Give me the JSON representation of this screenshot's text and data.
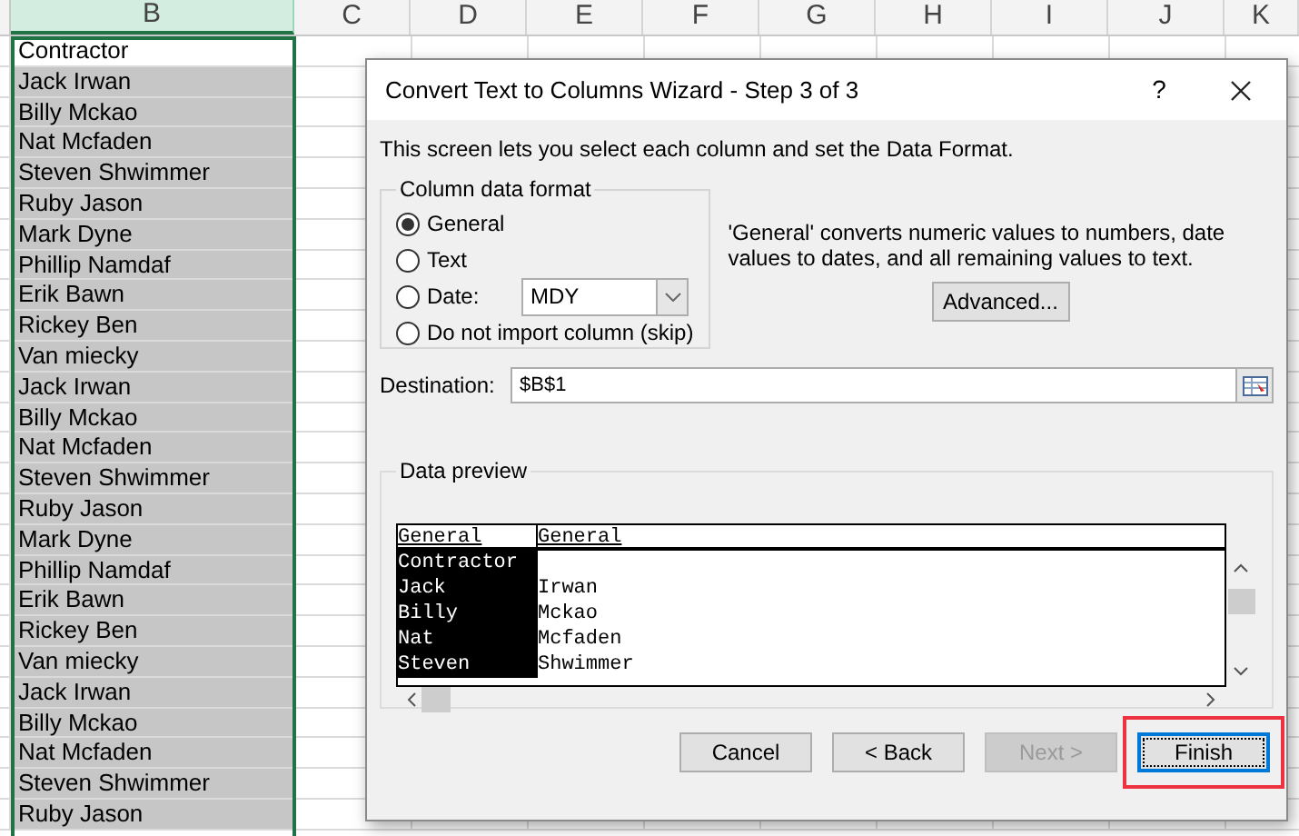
{
  "sheet": {
    "columns": [
      {
        "label": "B",
        "selected": true
      },
      {
        "label": "C",
        "selected": false
      },
      {
        "label": "D",
        "selected": false
      },
      {
        "label": "E",
        "selected": false
      },
      {
        "label": "F",
        "selected": false
      },
      {
        "label": "G",
        "selected": false
      },
      {
        "label": "H",
        "selected": false
      },
      {
        "label": "I",
        "selected": false
      },
      {
        "label": "J",
        "selected": false
      },
      {
        "label": "K",
        "selected": false
      }
    ],
    "cells": [
      {
        "text": "Contractor",
        "selected": false
      },
      {
        "text": "Jack Irwan",
        "selected": true
      },
      {
        "text": "Billy Mckao",
        "selected": true
      },
      {
        "text": "Nat Mcfaden",
        "selected": true
      },
      {
        "text": "Steven Shwimmer",
        "selected": true
      },
      {
        "text": "Ruby Jason",
        "selected": true
      },
      {
        "text": "Mark Dyne",
        "selected": true
      },
      {
        "text": "Phillip Namdaf",
        "selected": true
      },
      {
        "text": "Erik Bawn",
        "selected": true
      },
      {
        "text": "Rickey Ben",
        "selected": true
      },
      {
        "text": "Van miecky",
        "selected": true
      },
      {
        "text": "Jack Irwan",
        "selected": true
      },
      {
        "text": "Billy Mckao",
        "selected": true
      },
      {
        "text": "Nat Mcfaden",
        "selected": true
      },
      {
        "text": "Steven Shwimmer",
        "selected": true
      },
      {
        "text": "Ruby Jason",
        "selected": true
      },
      {
        "text": "Mark Dyne",
        "selected": true
      },
      {
        "text": "Phillip Namdaf",
        "selected": true
      },
      {
        "text": "Erik Bawn",
        "selected": true
      },
      {
        "text": "Rickey Ben",
        "selected": true
      },
      {
        "text": "Van miecky",
        "selected": true
      },
      {
        "text": "Jack Irwan",
        "selected": true
      },
      {
        "text": "Billy Mckao",
        "selected": true
      },
      {
        "text": "Nat Mcfaden",
        "selected": true
      },
      {
        "text": "Steven Shwimmer",
        "selected": true
      },
      {
        "text": "Ruby Jason",
        "selected": true
      }
    ]
  },
  "dialog": {
    "title": "Convert Text to Columns Wizard - Step 3 of 3",
    "help": "?",
    "intro": "This screen lets you select each column and set the Data Format.",
    "format_group": {
      "title": "Column data format",
      "options": [
        {
          "label": "General",
          "selected": true
        },
        {
          "label": "Text",
          "selected": false
        },
        {
          "label": "Date:",
          "selected": false
        },
        {
          "label": "Do not import column (skip)",
          "selected": false
        }
      ],
      "date_order": "MDY"
    },
    "description": "'General' converts numeric values to numbers, date values to dates, and all remaining values to text.",
    "advanced_button": "Advanced...",
    "destination": {
      "label": "Destination:",
      "value": "$B$1"
    },
    "preview": {
      "title": "Data preview",
      "columns": [
        {
          "header": "General",
          "selected": true
        },
        {
          "header": "General",
          "selected": false
        }
      ],
      "rows": [
        [
          "Contractor",
          ""
        ],
        [
          "Jack",
          "Irwan"
        ],
        [
          "Billy",
          "Mckao"
        ],
        [
          "Nat",
          "Mcfaden"
        ],
        [
          "Steven",
          "Shwimmer"
        ]
      ]
    },
    "buttons": [
      {
        "label": "Cancel",
        "disabled": false,
        "default": false,
        "highlighted": false
      },
      {
        "label": "< Back",
        "disabled": false,
        "default": false,
        "highlighted": false
      },
      {
        "label": "Next >",
        "disabled": true,
        "default": false,
        "highlighted": false
      },
      {
        "label": "Finish",
        "disabled": false,
        "default": true,
        "highlighted": true
      }
    ]
  }
}
